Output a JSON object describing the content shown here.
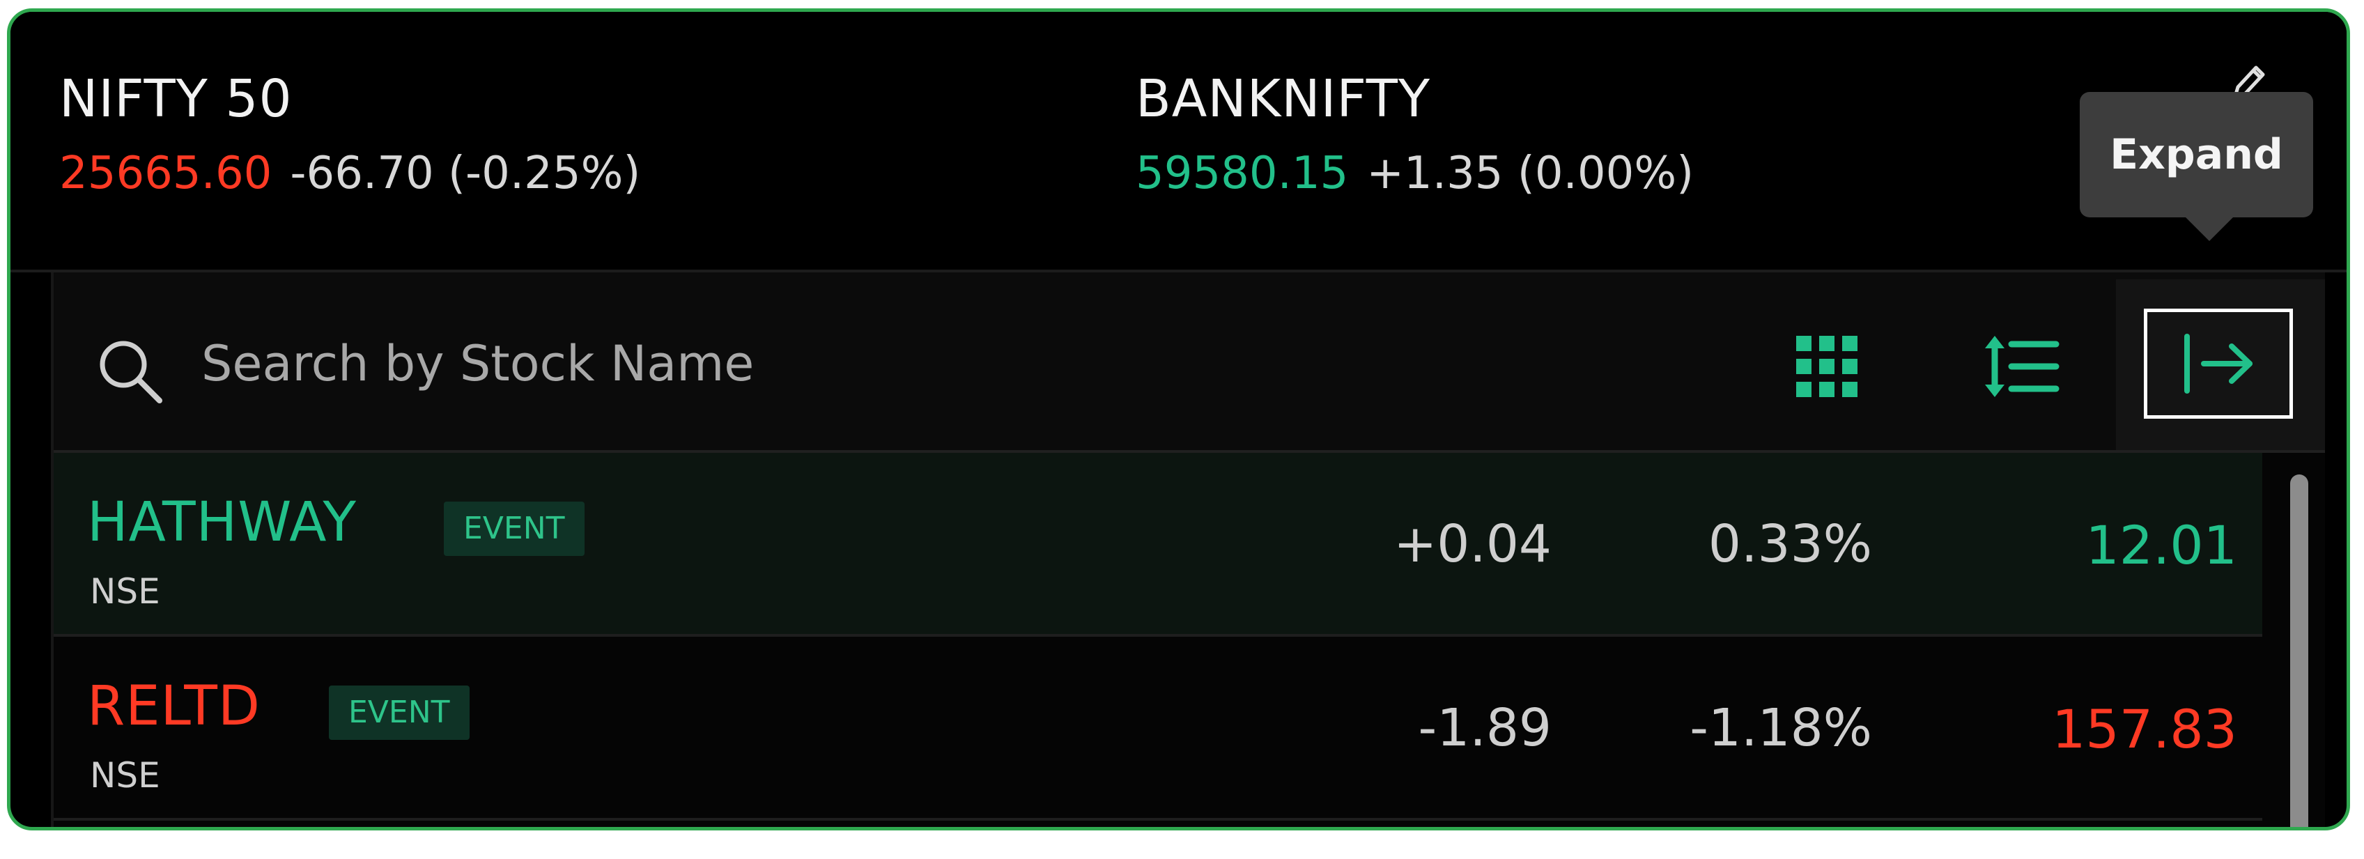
{
  "indices": [
    {
      "name": "NIFTY 50",
      "price": "25665.60",
      "change": "-66.70 (-0.25%)",
      "color": "#ff3a24"
    },
    {
      "name": "BANKNIFTY",
      "price": "59580.15",
      "change": "+1.35 (0.00%)",
      "color": "#22c08a"
    }
  ],
  "header": {
    "edit_icon": "pencil-icon"
  },
  "tooltip": {
    "label": "Expand"
  },
  "search": {
    "placeholder": "Search by Stock Name",
    "value": ""
  },
  "toolbar": {
    "grid_icon": "grid-icon",
    "sort_icon": "sort-list-icon",
    "expand_icon": "expand-arrow-icon"
  },
  "stocks": [
    {
      "symbol": "HATHWAY",
      "badge": "EVENT",
      "exchange": "NSE",
      "change": "+0.04",
      "change_pct": "0.33%",
      "ltp": "12.01",
      "direction": "up"
    },
    {
      "symbol": "RELTD",
      "badge": "EVENT",
      "exchange": "NSE",
      "change": "-1.89",
      "change_pct": "-1.18%",
      "ltp": "157.83",
      "direction": "down"
    }
  ],
  "colors": {
    "up": "#22c08a",
    "down": "#ff3a24",
    "accent_border": "#2fa84f"
  }
}
